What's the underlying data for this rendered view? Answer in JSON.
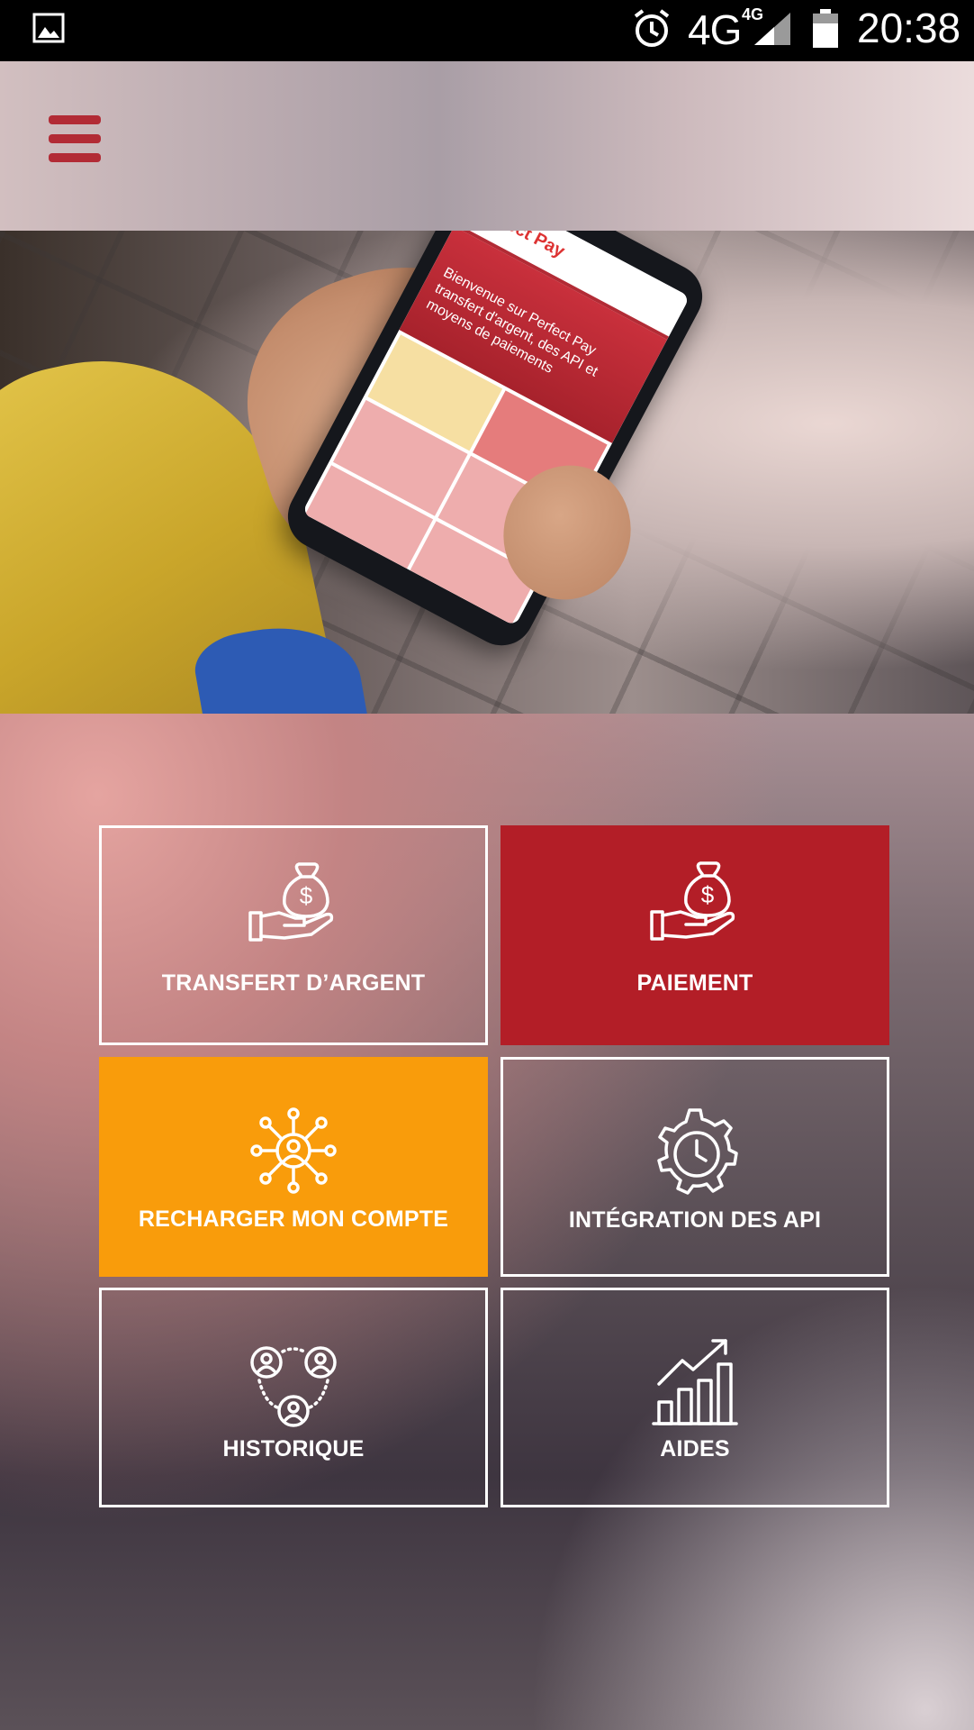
{
  "status_bar": {
    "network": "4G",
    "network_small": "4G",
    "time": "20:38",
    "icons": [
      "gallery-icon",
      "alarm-icon",
      "signal-icon",
      "battery-icon"
    ]
  },
  "header": {
    "menu_icon": "hamburger-menu-icon",
    "menu_color": "#b22b35"
  },
  "hero": {
    "phone_logo": "Perfect Pay",
    "phone_text": "Bienvenue sur Perfect Pay transfert d'argent, des API et moyens de paiements"
  },
  "tiles": [
    {
      "label": "TRANSFERT D’ARGENT",
      "icon": "money-bag-hand-icon",
      "style": "outline"
    },
    {
      "label": "PAIEMENT",
      "icon": "money-bag-hand-icon",
      "style": "red",
      "color": "#b31e27"
    },
    {
      "label": "RECHARGER MON COMPTE",
      "icon": "network-user-icon",
      "style": "orange",
      "color": "#f99c0b"
    },
    {
      "label": "INTÉGRATION DES API",
      "icon": "gear-clock-icon",
      "style": "outline"
    },
    {
      "label": "HISTORIQUE",
      "icon": "users-cycle-icon",
      "style": "outline"
    },
    {
      "label": "AIDES",
      "icon": "growth-chart-icon",
      "style": "outline"
    }
  ]
}
